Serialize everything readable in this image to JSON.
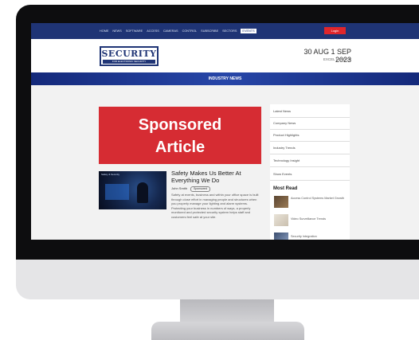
{
  "nav": {
    "items": [
      "HOME",
      "NEWS",
      "SOFTWARE",
      "ACCESS",
      "CAMERAS",
      "CONTROL",
      "SUBSCRIBE",
      "SECTORS"
    ],
    "active_item": "EVENTS",
    "login_label": "Login"
  },
  "header": {
    "logo_main": "SECURITY",
    "logo_sub": "FOR ELECTRONIC SECURITY",
    "date": "30 AUG 1 SEP 2023",
    "edition": "EXCEL LONDON"
  },
  "section_title": "INDUSTRY NEWS",
  "sponsored": {
    "line1": "Sponsored",
    "line2": "Article"
  },
  "article": {
    "thumb_label": "Safety & Security",
    "title": "Safety Makes Us Better At Everything We Do",
    "author": "John Smith",
    "tag": "Sponsored",
    "excerpt": "Safety at events, business and within your office space is built through close effort in managing people and structures when you properly manage your lighting and alarm systems. Protecting your business in numbers of ways, a properly monitored and protected security system helps staff and customers feel safe at your site."
  },
  "sidebar": {
    "links": [
      "Latest News",
      "Company News",
      "Product Highlights",
      "Industry Trends",
      "Technology Insight",
      "Show Events"
    ],
    "most_read_title": "Most Read",
    "most_read": [
      "Access Control Systems Market Growth",
      "Video Surveillance Trends",
      "Security Integration"
    ]
  },
  "colors": {
    "brand_navy": "#1f3475",
    "accent_red": "#d62c33",
    "login_red": "#e0262b"
  }
}
